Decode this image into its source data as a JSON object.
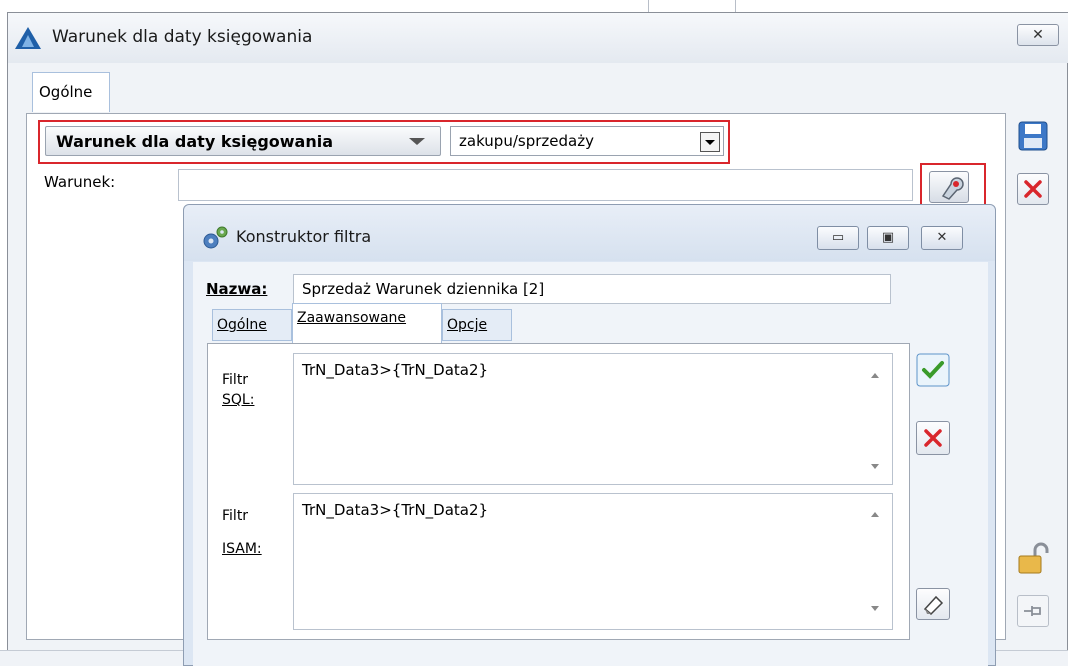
{
  "main_window": {
    "title": "Warunek dla daty księgowania",
    "close_symbol": "X",
    "tab": "Ogólne",
    "combo1_value": "Warunek dla daty księgowania",
    "combo2_value": "zakupu/sprzedaży",
    "warunek_label": "Warunek:",
    "warunek_value": ""
  },
  "filter_builder": {
    "title": "Konstruktor filtra",
    "nazwa_label": "Nazwa:",
    "nazwa_value": "Sprzedaż Warunek dziennika [2]",
    "tabs": [
      {
        "label": "Ogólne"
      },
      {
        "label": "Zaawansowane"
      },
      {
        "label": "Opcje"
      }
    ],
    "active_tab": "Zaawansowane",
    "filtr_sql_label_1": "Filtr",
    "filtr_sql_label_2": "SQL:",
    "filtr_sql_value": "TrN_Data3>{TrN_Data2}",
    "filtr_isam_label_1": "Filtr",
    "filtr_isam_label_2": "ISAM:",
    "filtr_isam_value": "TrN_Data3>{TrN_Data2}"
  },
  "icons": {
    "app": "app-logo-icon",
    "settings": "gear-icon",
    "wrench": "wrench-icon",
    "save": "floppy-icon",
    "cancel": "red-x-icon",
    "ok": "green-check-icon",
    "eraser": "eraser-icon",
    "lock": "padlock-icon",
    "pin": "pin-icon"
  },
  "colors": {
    "highlight_border": "#d9262c",
    "accent_blue": "#1f5fa8",
    "ok_green": "#3a9b2a",
    "cancel_red": "#d9262c"
  }
}
